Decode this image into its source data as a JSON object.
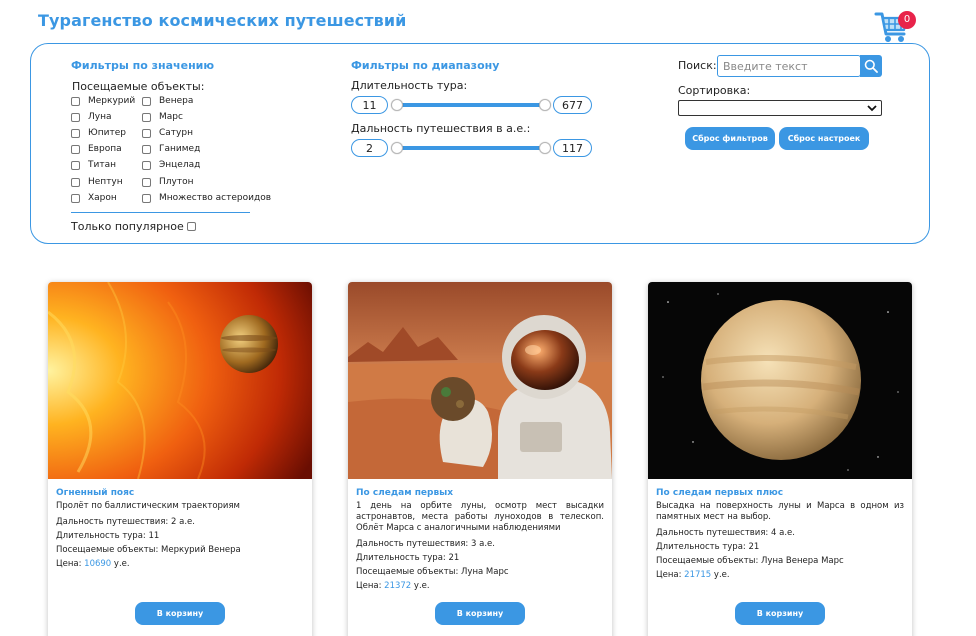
{
  "header": {
    "title": "Турагенство космических путешествий",
    "cart_count": "0",
    "cart_icon": "shopping-cart-icon"
  },
  "value_filters": {
    "title": "Фильтры по значению",
    "objects_label": "Посещаемые объекты:",
    "objects_left": [
      "Меркурий",
      "Луна",
      "Юпитер",
      "Европа",
      "Титан",
      "Нептун",
      "Харон"
    ],
    "objects_right": [
      "Венера",
      "Марс",
      "Сатурн",
      "Ганимед",
      "Энцелад",
      "Плутон",
      "Множество астероидов"
    ],
    "popular_label": "Только популярное"
  },
  "range_filters": {
    "title": "Фильтры по диапазону",
    "duration_label": "Длительность тура:",
    "duration_min": "11",
    "duration_max": "677",
    "distance_label": "Дальность путешествия в а.е.:",
    "distance_min": "2",
    "distance_max": "117"
  },
  "search": {
    "label": "Поиск:",
    "placeholder": "Введите текст",
    "icon": "search-icon"
  },
  "sort": {
    "label": "Сортировка:",
    "value": ""
  },
  "buttons": {
    "reset_filters": "Сброс фильтров",
    "reset_settings": "Сброс настроек"
  },
  "colors": {
    "accent": "#3b97e3",
    "badge": "#e8234a"
  },
  "cards": [
    {
      "title": "Огненный пояс",
      "desc": "Пролёт по баллистическим траекториям",
      "distance": "Дальность путешествия: 2 а.е.",
      "duration": "Длительность тура: 11",
      "objects": "Посещаемые объекты: Меркурий Венера",
      "price_label": "Цена:",
      "price": "10690",
      "currency": "у.е.",
      "button": "В корзину"
    },
    {
      "title": "По следам первых",
      "desc": "1 день на орбите луны, осмотр мест высадки астронавтов, места работы луноходов в телескоп. Облёт Марса с аналогичными наблюдениями",
      "distance": "Дальность путешествия: 3 а.е.",
      "duration": "Длительность тура: 21",
      "objects": "Посещаемые объекты: Луна Марс",
      "price_label": "Цена:",
      "price": "21372",
      "currency": "у.е.",
      "button": "В корзину"
    },
    {
      "title": "По следам первых плюс",
      "desc": "Высадка на поверхность луны и Марса в одном из памятных мест на выбор.",
      "distance": "Дальность путешествия: 4 а.е.",
      "duration": "Длительность тура: 21",
      "objects": "Посещаемые объекты: Луна Венера Марс",
      "price_label": "Цена:",
      "price": "21715",
      "currency": "у.е.",
      "button": "В корзину"
    }
  ]
}
